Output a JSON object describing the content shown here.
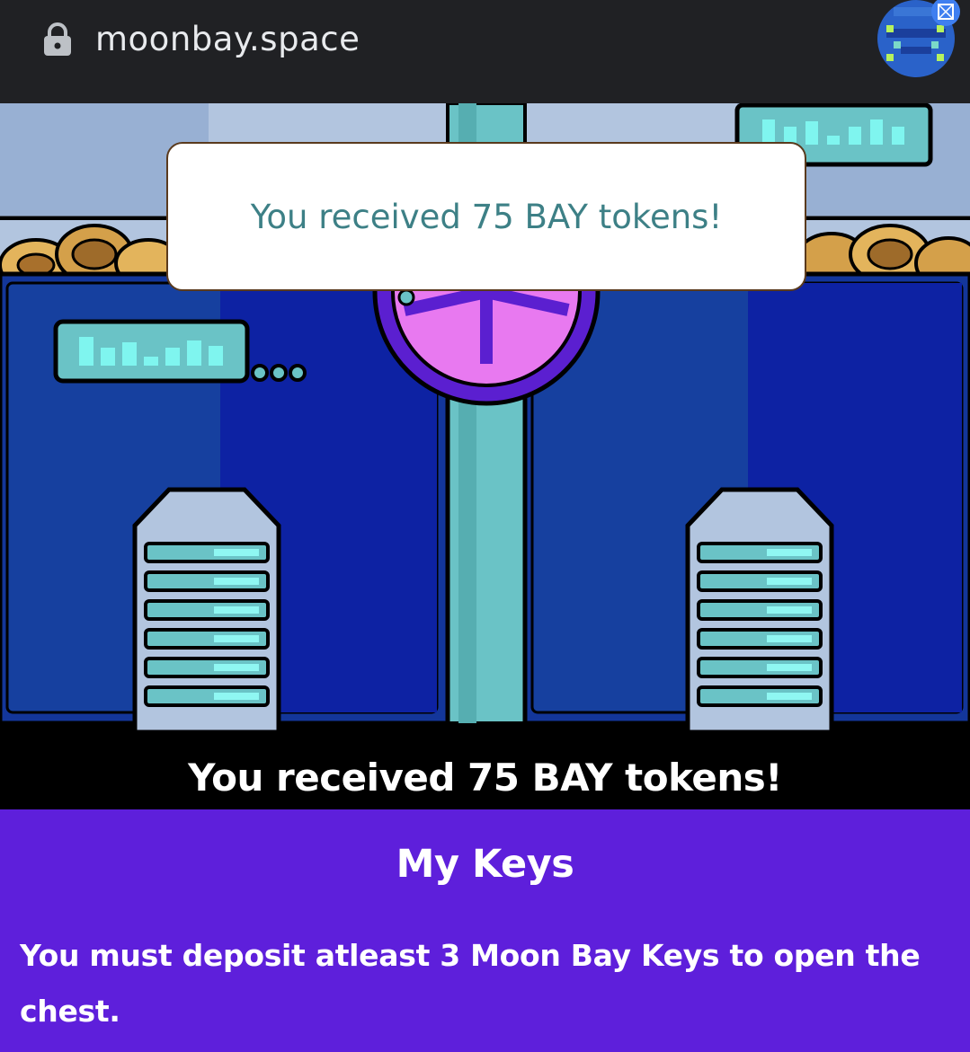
{
  "browser": {
    "url": "moonbay.space",
    "lock_icon": "lock-icon",
    "account_icon": "pixel-avatar-icon",
    "extension_icon": "wallet-extension-icon"
  },
  "scene": {
    "illustration": "vault-room-illustration",
    "colors": {
      "panel_blue": "#1a3a9e",
      "panel_dark": "#0c1d8a",
      "pipe_teal": "#6ac3c6",
      "wall_light": "#b2c5df",
      "dial_pink": "#e879f0",
      "dial_purple": "#7a2fe0"
    }
  },
  "toast": {
    "message": "You received 75 BAY tokens!"
  },
  "banner": {
    "message": "You received 75 BAY tokens!"
  },
  "keys_section": {
    "title": "My Keys",
    "notice": "You must deposit atleast 3 Moon Bay Keys to open the chest.",
    "background": "#5e1fdb"
  }
}
